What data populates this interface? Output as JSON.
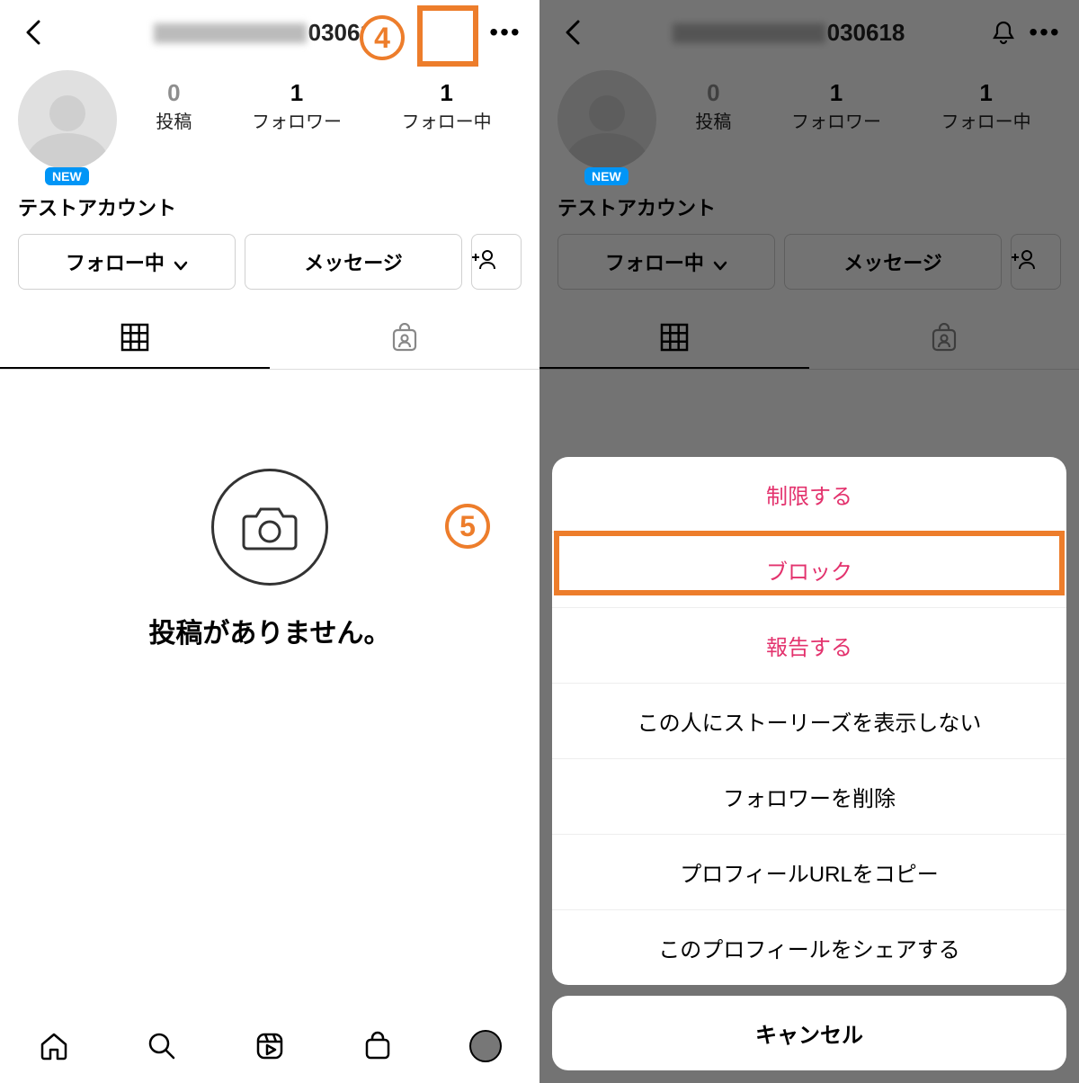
{
  "callouts": {
    "step4": "4",
    "step5": "5"
  },
  "header": {
    "username_obscured_suffix": "030618"
  },
  "profile": {
    "new_badge": "NEW",
    "display_name": "テストアカウント",
    "stats": {
      "posts_value": "0",
      "posts_label": "投稿",
      "followers_value": "1",
      "followers_label": "フォロワー",
      "following_value": "1",
      "following_label": "フォロー中"
    },
    "actions": {
      "follow": "フォロー中",
      "message": "メッセージ"
    },
    "empty_text": "投稿がありません。"
  },
  "sheet": {
    "restrict": "制限する",
    "block": "ブロック",
    "report": "報告する",
    "hide_story": "この人にストーリーズを表示しない",
    "remove_follower": "フォロワーを削除",
    "copy_url": "プロフィールURLをコピー",
    "share_profile": "このプロフィールをシェアする",
    "cancel": "キャンセル"
  }
}
